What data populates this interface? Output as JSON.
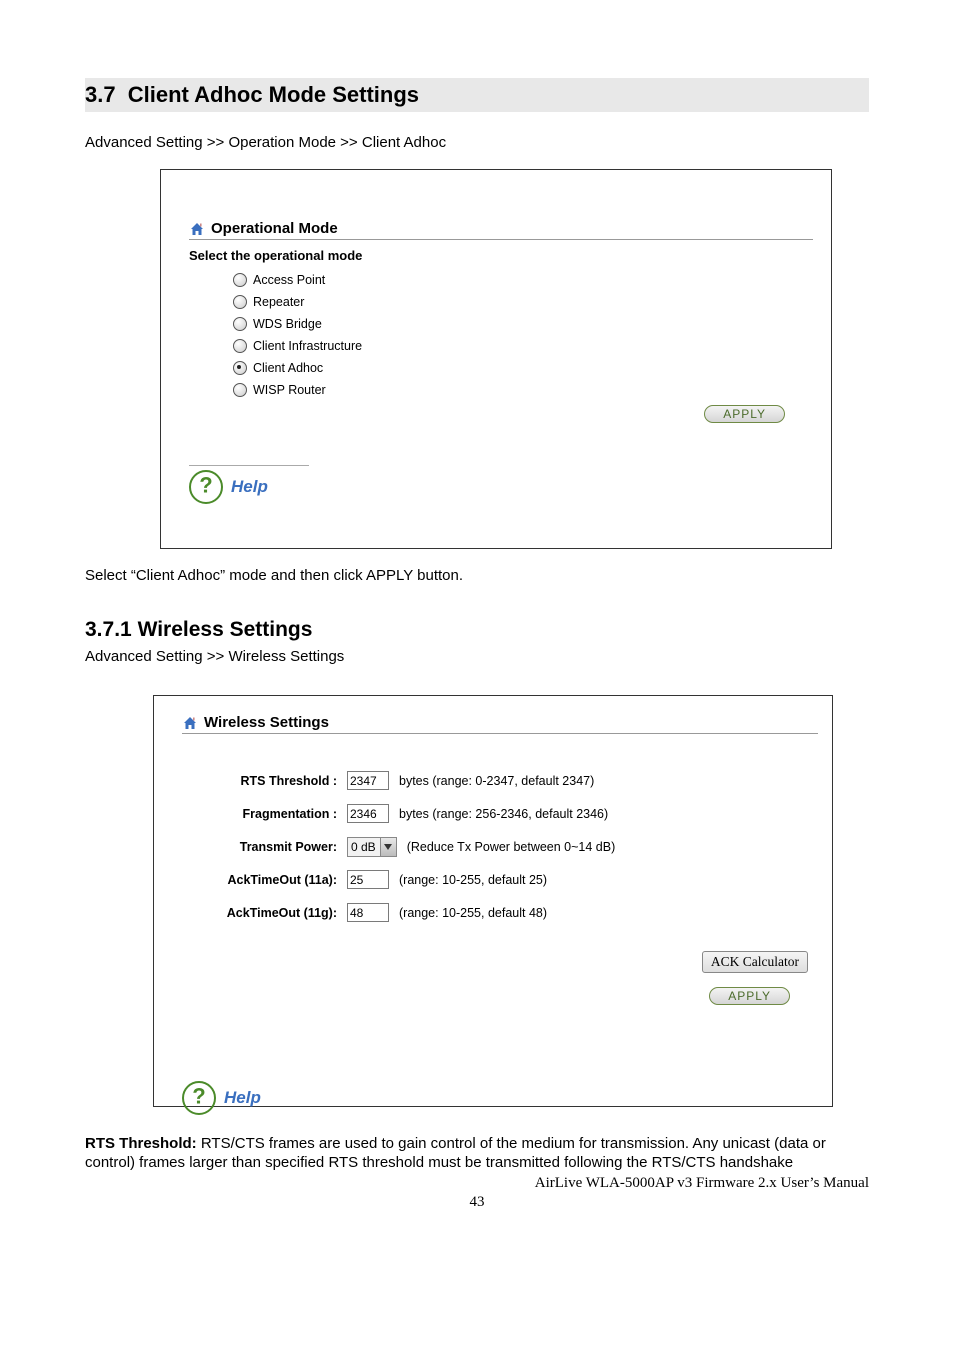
{
  "section": {
    "number": "3.7",
    "title": "Client  Adhoc  Mode  Settings",
    "breadcrumb": "Advanced Setting >> Operation Mode >> Client Adhoc"
  },
  "opMode": {
    "panelTitle": "Operational Mode",
    "groupLabel": "Select the operational mode",
    "options": [
      {
        "label": "Access Point",
        "checked": false
      },
      {
        "label": "Repeater",
        "checked": false
      },
      {
        "label": "WDS Bridge",
        "checked": false
      },
      {
        "label": "Client Infrastructure",
        "checked": false
      },
      {
        "label": "Client Adhoc",
        "checked": true
      },
      {
        "label": "WISP Router",
        "checked": false
      }
    ],
    "applyLabel": "APPLY",
    "help": "Help"
  },
  "caption": "Select “Client Adhoc” mode and then click APPLY button.",
  "sub": {
    "number": "3.7.1",
    "title": "Wireless Settings",
    "breadcrumb": "Advanced Setting >> Wireless Settings"
  },
  "wireless": {
    "panelTitle": "Wireless Settings",
    "rows": {
      "rts": {
        "label": "RTS Threshold :",
        "value": "2347",
        "hint": "bytes (range: 0-2347, default 2347)"
      },
      "frag": {
        "label": "Fragmentation :",
        "value": "2346",
        "hint": "bytes (range: 256-2346, default 2346)"
      },
      "txp": {
        "label": "Transmit Power:",
        "value": "0 dB",
        "hint": "(Reduce Tx Power between 0~14 dB)"
      },
      "a11a": {
        "label": "AckTimeOut (11a):",
        "value": "25",
        "hint": "(range: 10-255, default 25)"
      },
      "a11g": {
        "label": "AckTimeOut (11g):",
        "value": "48",
        "hint": "(range: 10-255, default 48)"
      }
    },
    "ackCalc": "ACK Calculator",
    "applyLabel": "APPLY",
    "help": "Help"
  },
  "bodyText": {
    "boldLead": "RTS Threshold:",
    "rest": " RTS/CTS frames are used to gain control of the medium for transmission. Any unicast (data or control) frames larger than specified RTS threshold must be transmitted following the RTS/CTS handshake"
  },
  "footer": "AirLive WLA-5000AP v3 Firmware 2.x User’s Manual",
  "pageNumber": "43"
}
